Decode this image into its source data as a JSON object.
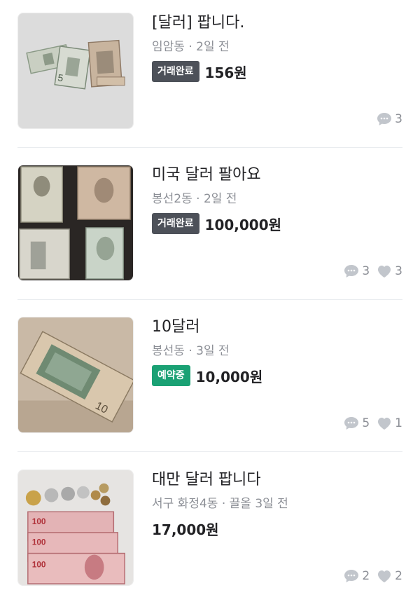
{
  "colors": {
    "badge_done": "#4d5159",
    "badge_reserved": "#1aa174",
    "meta_text": "#8c8f96",
    "icon_gray": "#c2c6cc"
  },
  "items": [
    {
      "title": "[달러] 팝니다.",
      "meta": "임암동 · 2일 전",
      "badge": "거래완료",
      "price": "156원",
      "comments": "3",
      "likes": null,
      "image": "us-dollar-bills-photo"
    },
    {
      "title": "미국 달러 팔아요",
      "meta": "봉선2동 · 2일 전",
      "badge": "거래완료",
      "price": "100,000원",
      "comments": "3",
      "likes": "3",
      "image": "us-dollar-bills-on-dark-surface-photo"
    },
    {
      "title": "10달러",
      "meta": "봉선동 · 3일 전",
      "badge": "예약중",
      "price": "10,000원",
      "comments": "5",
      "likes": "1",
      "image": "ten-dollar-bill-photo"
    },
    {
      "title": "대만 달러 팝니다",
      "meta": "서구 화정4동 · 끌올 3일 전",
      "badge": null,
      "price": "17,000원",
      "comments": "2",
      "likes": "2",
      "image": "taiwan-dollar-bills-and-coins-photo"
    }
  ]
}
